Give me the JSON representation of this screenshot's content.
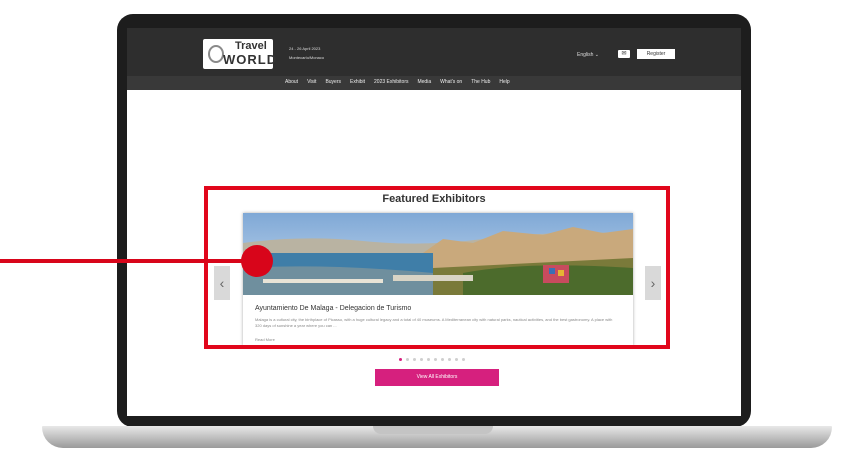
{
  "header": {
    "logo_line1": "Travel",
    "logo_line2": "WORLD",
    "event_dates": "24 - 26 April 2023",
    "event_venue": "Montecarlo/Monaco",
    "language": "English ⌄",
    "mail_icon": "envelope-icon",
    "register_label": "Register"
  },
  "nav": {
    "items": [
      "About",
      "Visit",
      "Buyers",
      "Exhibit",
      "2023 Exhibitors",
      "Media",
      "What's on",
      "The Hub",
      "Help"
    ]
  },
  "featured": {
    "title": "Featured Exhibitors",
    "card": {
      "title": "Ayuntamiento De Malaga - Delegacion de Turismo",
      "description": "Malaga is a cultural city, the birthplace of Picasso, with a huge cultural legacy and a total of 40 museums. A Mediterranean city with natural parks, nautical activities, and the best gastronomy. A place with 320 days of sunshine a year where you can ...",
      "read_more": "Read More"
    },
    "prev_icon": "chevron-left-icon",
    "next_icon": "chevron-right-icon",
    "prev_glyph": "‹",
    "next_glyph": "›",
    "dot_count": 10,
    "active_dot": 0,
    "view_all_label": "View All Exhibitors"
  },
  "annotation": {
    "color": "#e1061b"
  },
  "colors": {
    "header_bg": "#2e2e2e",
    "nav_bg": "#393939",
    "accent_pink": "#d6207e"
  }
}
